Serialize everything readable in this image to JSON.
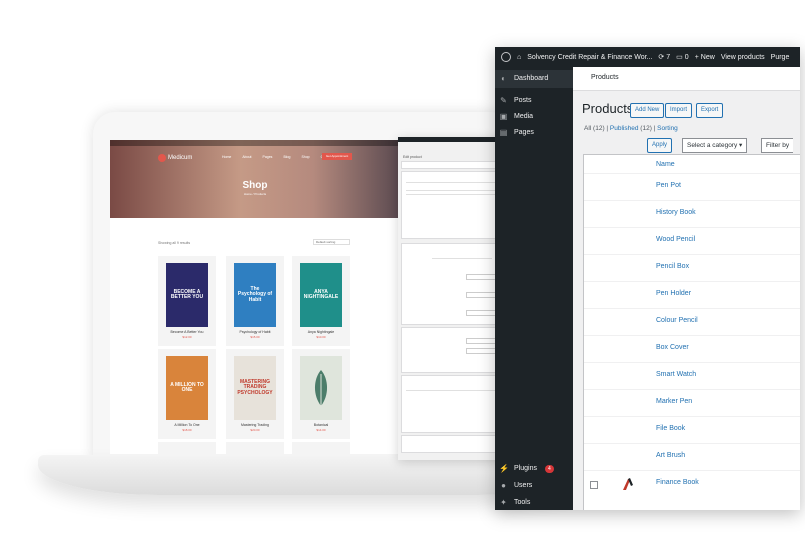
{
  "admin": {
    "site_name": "Solvency Credit Repair & Finance Wor...",
    "update_count": "7",
    "comment_count": "0",
    "new_label": "New",
    "view_label": "View products",
    "purge_label": "Purge",
    "subheader": "Products",
    "title": "Products",
    "buttons": {
      "add": "Add New",
      "import": "Import",
      "export": "Export"
    },
    "filters": {
      "all": "All",
      "all_count": "(12)",
      "published": "Published",
      "published_count": "(12)",
      "sorting": "Sorting"
    },
    "apply_label": "Apply",
    "category_select": "Select a category",
    "filter_select": "Filter by",
    "column_name": "Name",
    "products": [
      "Pen Pot",
      "History Book",
      "Wood Pencil",
      "Pencil Box",
      "Pen Holder",
      "Colour Pencil",
      "Box Cover",
      "Smart Watch",
      "Marker Pen",
      "File Book",
      "Art Brush",
      "Finance Book"
    ]
  },
  "sidebar": {
    "items": [
      {
        "label": "Dashboard",
        "icon": "dashboard-icon"
      },
      {
        "label": "Posts",
        "icon": "pin-icon"
      },
      {
        "label": "Media",
        "icon": "media-icon"
      },
      {
        "label": "Pages",
        "icon": "pages-icon"
      },
      {
        "label": "Plugins",
        "icon": "plugin-icon",
        "badge": "4"
      },
      {
        "label": "Users",
        "icon": "user-icon"
      },
      {
        "label": "Tools",
        "icon": "wrench-icon"
      }
    ]
  },
  "shop": {
    "logo": "Medicum",
    "menu": [
      "Home",
      "About",
      "Pages",
      "Blog",
      "Shop",
      "Contact"
    ],
    "cta": "Get Appointment",
    "title": "Shop",
    "breadcrumb": "Home / Products",
    "results": "Showing all 9 results",
    "sort": "Default sorting",
    "books": [
      {
        "name": "Become A Better You",
        "price": "$12.00",
        "cover": "BECOME A BETTER YOU",
        "color": "#2b2a6a"
      },
      {
        "name": "Psychology of Habit",
        "price": "$15.00",
        "cover": "The Psychology of Habit",
        "color": "#2f7fc1"
      },
      {
        "name": "Anya Nightingale",
        "price": "$10.00",
        "cover": "ANYA NIGHTINGALE",
        "color": "#1f8f8a"
      },
      {
        "name": "A Million To One",
        "price": "$18.00",
        "cover": "A MILLION TO ONE",
        "color": "#d9843b"
      },
      {
        "name": "Mastering Trading",
        "price": "$20.00",
        "cover": "MASTERING TRADING PSYCHOLOGY",
        "color": "#e7e2da"
      },
      {
        "name": "Botanical",
        "price": "$14.00",
        "cover": "",
        "color": "#dfe5dc"
      }
    ]
  },
  "editor": {
    "title": "Edit product"
  },
  "colors": {
    "accent": "#2271b1",
    "brand_red": "#e2574c",
    "admin_dark": "#1d2327"
  }
}
